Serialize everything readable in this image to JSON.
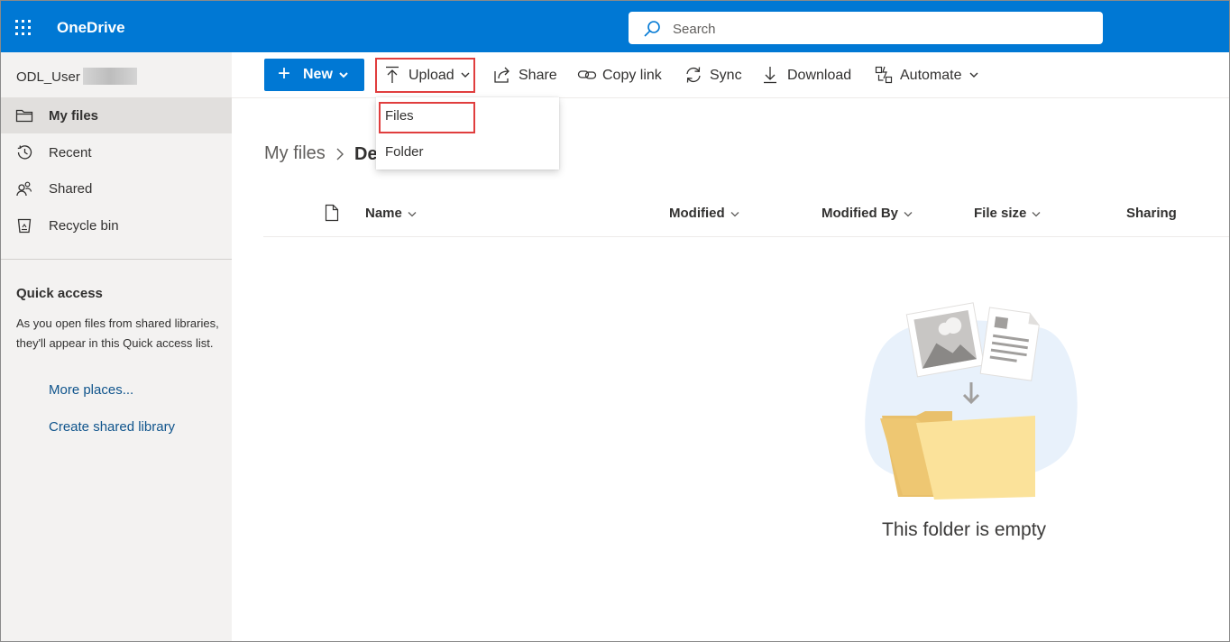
{
  "app": {
    "name": "OneDrive"
  },
  "search": {
    "placeholder": "Search"
  },
  "user": {
    "name": "ODL_User"
  },
  "sidebar": {
    "items": [
      {
        "label": "My files",
        "icon": "folder-icon",
        "active": true
      },
      {
        "label": "Recent",
        "icon": "clock-icon",
        "active": false
      },
      {
        "label": "Shared",
        "icon": "people-icon",
        "active": false
      },
      {
        "label": "Recycle bin",
        "icon": "recycle-bin-icon",
        "active": false
      }
    ],
    "quick_access": {
      "title": "Quick access",
      "description": "As you open files from shared libraries, they'll appear in this Quick access list.",
      "links": [
        "More places...",
        "Create shared library"
      ]
    }
  },
  "toolbar": {
    "new_label": "New",
    "upload_label": "Upload",
    "share_label": "Share",
    "copy_link_label": "Copy link",
    "sync_label": "Sync",
    "download_label": "Download",
    "automate_label": "Automate"
  },
  "upload_menu": {
    "items": [
      "Files",
      "Folder"
    ]
  },
  "breadcrumb": {
    "root": "My files",
    "current": "De"
  },
  "table": {
    "columns": [
      "Name",
      "Modified",
      "Modified By",
      "File size",
      "Sharing"
    ]
  },
  "empty_state": {
    "message": "This folder is empty"
  },
  "colors": {
    "brand": "#0078d4",
    "highlight": "#e03e3e",
    "sidebar_bg": "#f3f2f1"
  }
}
